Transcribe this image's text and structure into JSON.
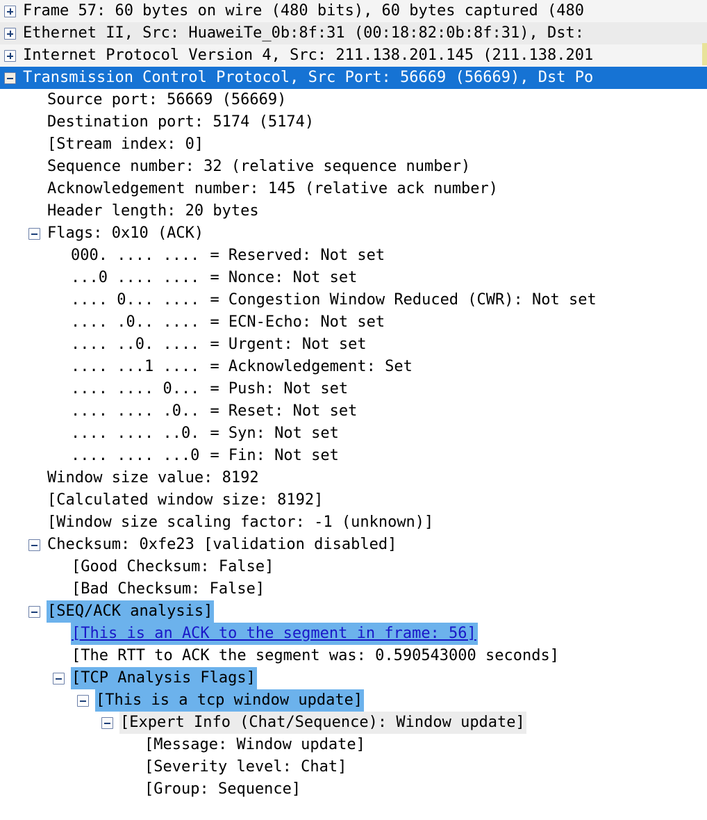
{
  "pane": {
    "name": "packet-details",
    "selected_row_index": 3,
    "colors": {
      "selection_blue": "#1673d4",
      "highlight_blue": "#6cb2ec",
      "expert_gray": "#ececec",
      "link_blue": "#1a18c8",
      "text_black": "#000000",
      "selected_text": "#ffffff"
    }
  },
  "rows": [
    {
      "text": "Frame 57: 60 bytes on wire (480 bits), 60 bytes captured (480",
      "indent": 0,
      "toggle": "plus",
      "style": "stripe",
      "name": "tree-row-frame"
    },
    {
      "text": "Ethernet II, Src: HuaweiTe_0b:8f:31 (00:18:82:0b:8f:31), Dst:",
      "indent": 0,
      "toggle": "plus",
      "style": "stripe2",
      "name": "tree-row-ethernet"
    },
    {
      "text": "Internet Protocol Version 4, Src: 211.138.201.145 (211.138.201",
      "indent": 0,
      "toggle": "plus",
      "style": "stripe",
      "name": "tree-row-ipv4"
    },
    {
      "text": "Transmission Control Protocol, Src Port: 56669 (56669), Dst Po",
      "indent": 0,
      "toggle": "minus",
      "style": "selected",
      "name": "tree-row-tcp"
    },
    {
      "text": "Source port: 56669 (56669)",
      "indent": 1,
      "toggle": "none",
      "style": "plain",
      "name": "tree-row-source-port"
    },
    {
      "text": "Destination port: 5174 (5174)",
      "indent": 1,
      "toggle": "none",
      "style": "plain",
      "name": "tree-row-destination-port"
    },
    {
      "text": "[Stream index: 0]",
      "indent": 1,
      "toggle": "none",
      "style": "plain",
      "name": "tree-row-stream-index"
    },
    {
      "text": "Sequence number: 32    (relative sequence number)",
      "indent": 1,
      "toggle": "none",
      "style": "plain",
      "name": "tree-row-sequence-number"
    },
    {
      "text": "Acknowledgement number: 145    (relative ack number)",
      "indent": 1,
      "toggle": "none",
      "style": "plain",
      "name": "tree-row-acknowledgement-number"
    },
    {
      "text": "Header length: 20 bytes",
      "indent": 1,
      "toggle": "none",
      "style": "plain",
      "name": "tree-row-header-length"
    },
    {
      "text": "Flags: 0x10 (ACK)",
      "indent": 1,
      "toggle": "minus",
      "style": "plain",
      "name": "tree-row-flags"
    },
    {
      "bits": "000. .... ....",
      "text": "= Reserved: Not set",
      "indent": 2,
      "toggle": "none",
      "style": "plain",
      "name": "tree-row-flag-reserved"
    },
    {
      "bits": "...0 .... ....",
      "text": "= Nonce: Not set",
      "indent": 2,
      "toggle": "none",
      "style": "plain",
      "name": "tree-row-flag-nonce"
    },
    {
      "bits": ".... 0... ....",
      "text": "= Congestion Window Reduced (CWR): Not set",
      "indent": 2,
      "toggle": "none",
      "style": "plain",
      "name": "tree-row-flag-cwr"
    },
    {
      "bits": ".... .0.. ....",
      "text": "= ECN-Echo: Not set",
      "indent": 2,
      "toggle": "none",
      "style": "plain",
      "name": "tree-row-flag-ecn-echo"
    },
    {
      "bits": ".... ..0. ....",
      "text": "= Urgent: Not set",
      "indent": 2,
      "toggle": "none",
      "style": "plain",
      "name": "tree-row-flag-urgent"
    },
    {
      "bits": ".... ...1 ....",
      "text": "= Acknowledgement: Set",
      "indent": 2,
      "toggle": "none",
      "style": "plain",
      "name": "tree-row-flag-acknowledgement"
    },
    {
      "bits": ".... .... 0...",
      "text": "= Push: Not set",
      "indent": 2,
      "toggle": "none",
      "style": "plain",
      "name": "tree-row-flag-push"
    },
    {
      "bits": ".... .... .0..",
      "text": "= Reset: Not set",
      "indent": 2,
      "toggle": "none",
      "style": "plain",
      "name": "tree-row-flag-reset"
    },
    {
      "bits": ".... .... ..0.",
      "text": "= Syn: Not set",
      "indent": 2,
      "toggle": "none",
      "style": "plain",
      "name": "tree-row-flag-syn"
    },
    {
      "bits": ".... .... ...0",
      "text": "= Fin: Not set",
      "indent": 2,
      "toggle": "none",
      "style": "plain",
      "name": "tree-row-flag-fin"
    },
    {
      "text": "Window size value: 8192",
      "indent": 1,
      "toggle": "none",
      "style": "plain",
      "name": "tree-row-window-size-value"
    },
    {
      "text": "[Calculated window size: 8192]",
      "indent": 1,
      "toggle": "none",
      "style": "plain",
      "name": "tree-row-calculated-window-size"
    },
    {
      "text": "[Window size scaling factor: -1 (unknown)]",
      "indent": 1,
      "toggle": "none",
      "style": "plain",
      "name": "tree-row-window-scaling-factor"
    },
    {
      "text": "Checksum: 0xfe23 [validation disabled]",
      "indent": 1,
      "toggle": "minus",
      "style": "plain",
      "name": "tree-row-checksum"
    },
    {
      "text": "[Good Checksum: False]",
      "indent": 2,
      "toggle": "none",
      "style": "plain",
      "name": "tree-row-good-checksum"
    },
    {
      "text": "[Bad Checksum: False]",
      "indent": 2,
      "toggle": "none",
      "style": "plain",
      "name": "tree-row-bad-checksum"
    },
    {
      "text": "[SEQ/ACK analysis]",
      "indent": 1,
      "toggle": "minus",
      "style": "hilite",
      "name": "tree-row-seq-ack-analysis"
    },
    {
      "text": "[This is an ACK to the segment in frame: 56]",
      "indent": 2,
      "toggle": "none",
      "style": "link",
      "name": "tree-row-ack-to-segment-link"
    },
    {
      "text": "[The RTT to ACK the segment was: 0.590543000 seconds]",
      "indent": 2,
      "toggle": "none",
      "style": "plain",
      "name": "tree-row-rtt-to-ack"
    },
    {
      "text": "[TCP Analysis Flags]",
      "indent": 2,
      "toggle": "minus",
      "style": "hilite",
      "name": "tree-row-tcp-analysis-flags"
    },
    {
      "text": "[This is a tcp window update]",
      "indent": 3,
      "toggle": "minus",
      "style": "hilite",
      "name": "tree-row-tcp-window-update"
    },
    {
      "text": "[Expert Info (Chat/Sequence): Window update]",
      "indent": 4,
      "toggle": "minus",
      "style": "grayband",
      "name": "tree-row-expert-info"
    },
    {
      "text": "[Message: Window update]",
      "indent": 5,
      "toggle": "none",
      "style": "plain",
      "name": "tree-row-expert-message"
    },
    {
      "text": "[Severity level: Chat]",
      "indent": 5,
      "toggle": "none",
      "style": "plain",
      "name": "tree-row-expert-severity"
    },
    {
      "text": "[Group: Sequence]",
      "indent": 5,
      "toggle": "none",
      "style": "plain",
      "name": "tree-row-expert-group"
    }
  ]
}
